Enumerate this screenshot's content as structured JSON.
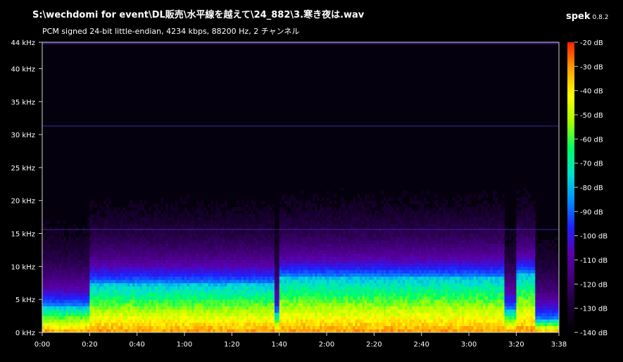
{
  "header": {
    "title": "S:\\wechdomi for event\\DL販売\\水平線を越えて\\24_882\\3.寒き夜は.wav",
    "subtitle": "PCM signed 24-bit little-endian, 4234 kbps, 88200 Hz, 2 チャンネル",
    "app_name": "spek",
    "app_version": "0.8.2"
  },
  "chart_data": {
    "type": "heatmap",
    "title": "",
    "xlabel": "",
    "ylabel": "",
    "x_ticks": [
      "0:00",
      "0:20",
      "0:40",
      "1:00",
      "1:20",
      "1:40",
      "2:00",
      "2:20",
      "2:40",
      "3:00",
      "3:20",
      "3:38"
    ],
    "x_tick_seconds": [
      0,
      20,
      40,
      60,
      80,
      100,
      120,
      140,
      160,
      180,
      200,
      218
    ],
    "xlim": [
      0,
      218
    ],
    "y_ticks": [
      "0 kHz",
      "5 kHz",
      "10 kHz",
      "15 kHz",
      "20 kHz",
      "25 kHz",
      "30 kHz",
      "35 kHz",
      "40 kHz",
      "44 kHz"
    ],
    "y_tick_khz": [
      0,
      5,
      10,
      15,
      20,
      25,
      30,
      35,
      40,
      44
    ],
    "ylim": [
      0,
      44
    ],
    "colorbar_ticks": [
      "-20 dB",
      "-30 dB",
      "-40 dB",
      "-50 dB",
      "-60 dB",
      "-70 dB",
      "-80 dB",
      "-90 dB",
      "-100 dB",
      "-110 dB",
      "-120 dB",
      "-130 dB",
      "-140 dB"
    ],
    "colorbar_db": [
      -20,
      -30,
      -40,
      -50,
      -60,
      -70,
      -80,
      -90,
      -100,
      -110,
      -120,
      -130,
      -140
    ],
    "colorbar_range": [
      -140,
      -20
    ],
    "colormap": [
      "#000000",
      "#1a0033",
      "#3d0070",
      "#5a00a8",
      "#2020ff",
      "#0090ff",
      "#00e0d0",
      "#00ff60",
      "#a8ff00",
      "#ffff00",
      "#ffa000",
      "#ff2000"
    ],
    "reference_lines_khz": [
      15.6,
      31.3
    ],
    "energy_bands": [
      {
        "t_start": 0,
        "t_end": 20,
        "high_khz": 4
      },
      {
        "t_start": 20,
        "t_end": 98,
        "high_khz": 7.5
      },
      {
        "t_start": 98,
        "t_end": 100,
        "high_khz": 3
      },
      {
        "t_start": 100,
        "t_end": 195,
        "high_khz": 8.5
      },
      {
        "t_start": 195,
        "t_end": 200,
        "high_khz": 3.5
      },
      {
        "t_start": 200,
        "t_end": 208,
        "high_khz": 9
      },
      {
        "t_start": 208,
        "t_end": 218,
        "high_khz": 2
      }
    ]
  }
}
